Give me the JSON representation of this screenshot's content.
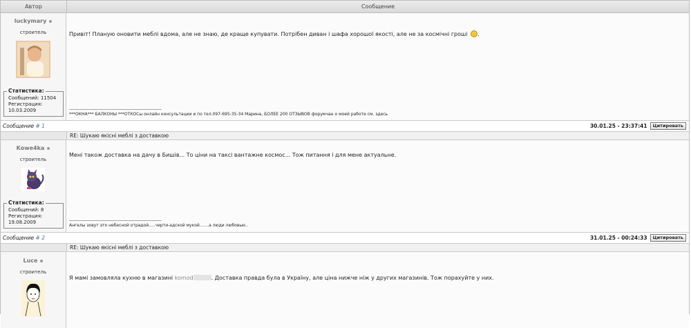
{
  "header": {
    "author_col": "Автор",
    "message_col": "Сообщение"
  },
  "posts": [
    {
      "author": "luckymary",
      "rank": "строитель",
      "stats": {
        "legend": "Статистика:",
        "messages": "Сообщений: 11504",
        "reg_label": "Регистрация:",
        "reg_date": "10.03.2009"
      },
      "text": "Привіт! Планую оновити меблі вдома, але не знаю, де краще купувати. Потрібен диван і шафа хорошої якості, але не за космічні гроші",
      "sig_line": "--------------------------------------------------------------------",
      "signature": "***ОКНА*** БАЛКОНЫ ***ОТКОСы онлайн консультации и по тел.097-695-35-34 Марина, БОЛЕЕ 200 ОТЗЫВОВ форумчан о моей работе см. здесь",
      "footer_label": "Сообщение",
      "footer_num": "# 1",
      "date": "30.01.25 - 23:37:41",
      "quote_btn": "Цитировать"
    },
    {
      "subject": "RE: Шукаю якісні меблі з доставкою",
      "author": "Kowe4ka",
      "rank": "строитель",
      "stats": {
        "legend": "Статистика:",
        "messages": "Сообщений: 8",
        "reg_label": "Регистрация:",
        "reg_date": "19.08.2009"
      },
      "text": "Мені також доставка на дачу в Бишів... То ціни на таксі вантажне космос... Тож питання і для мене актуальне.",
      "sig_line": "--------------------------------------------------------------------",
      "signature": "Ангелы зовут это небесной отрадой.....черти-адской мукой.......а люди любовью..",
      "footer_label": "Сообщение",
      "footer_num": "# 2",
      "date": "31.01.25 - 00:24:33",
      "quote_btn": "Цитировать"
    },
    {
      "subject": "RE: Шукаю якісні меблі з доставкою",
      "author": "Luce",
      "rank": "строитель",
      "text_before": "Я мамі замовляла кухню в магазині",
      "shop": "komod",
      "text_after": ". Доставка правда була в Україну, але ціна нижче ніж у других магазинів. Тож порахуйте у них."
    }
  ]
}
